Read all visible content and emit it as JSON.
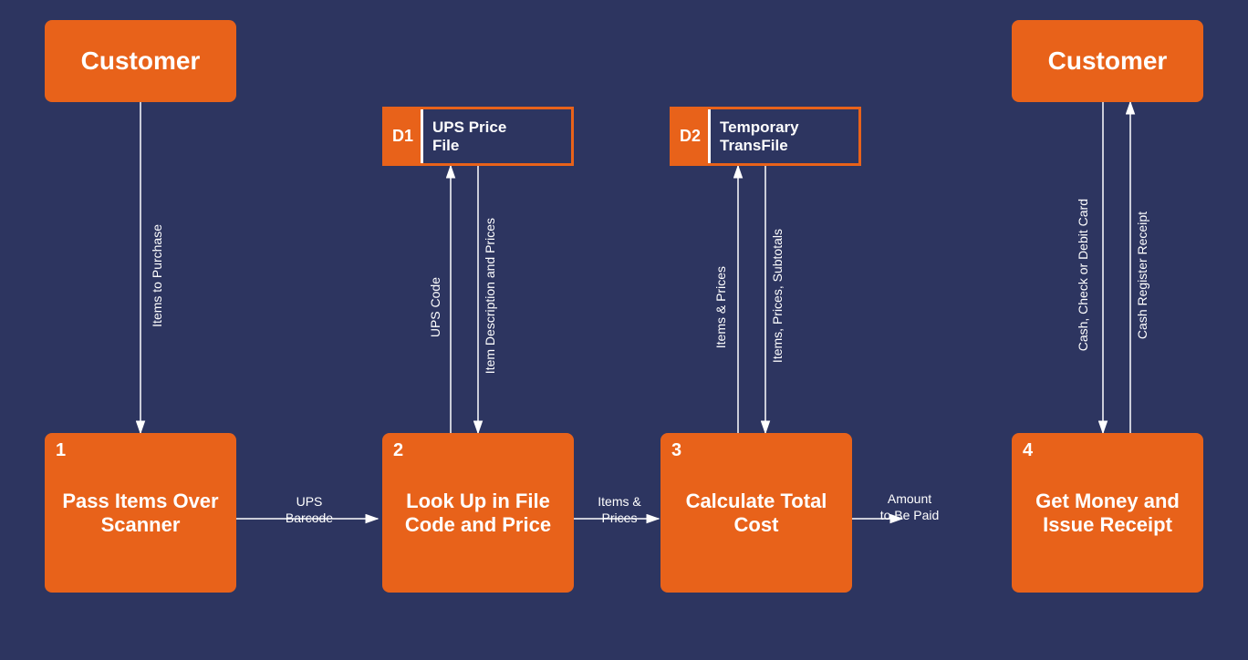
{
  "diagram": {
    "background": "#2d3560",
    "accent": "#e8621a",
    "actors": [
      {
        "id": "actor-left",
        "label": "Customer",
        "col": 1
      },
      {
        "id": "actor-right",
        "label": "Customer",
        "col": 4
      }
    ],
    "datastores": [
      {
        "id": "D1",
        "name": "UPS Price\nFile",
        "col": 2
      },
      {
        "id": "D2",
        "name": "Temporary\nTransFile",
        "col": 3
      }
    ],
    "processes": [
      {
        "number": "1",
        "label": "Pass Items Over\nScanner",
        "col": 1
      },
      {
        "number": "2",
        "label": "Look Up in File\nCode and Price",
        "col": 2
      },
      {
        "number": "3",
        "label": "Calculate Total\nCost",
        "col": 3
      },
      {
        "number": "4",
        "label": "Get Money and\nIssue Receipt",
        "col": 4
      }
    ],
    "flow_labels": {
      "actor1_to_proc1": "Items to Purchase",
      "proc1_to_proc2": "UPS\nBarcode",
      "proc2_to_proc3": "Items &\nPrices",
      "proc3_to_proc4": "Amount\nto Be Paid",
      "proc4_to_actor2": "Cash Register Receipt",
      "actor2_to_proc4": "Cash, Check or Debit Card",
      "d1_to_proc2_down": "Item Description and Prices",
      "proc2_to_d1_up": "UPS Code",
      "d2_to_proc3_down": "Items, Prices, Subtotals",
      "proc3_to_d2_up": "Items & Prices"
    }
  }
}
